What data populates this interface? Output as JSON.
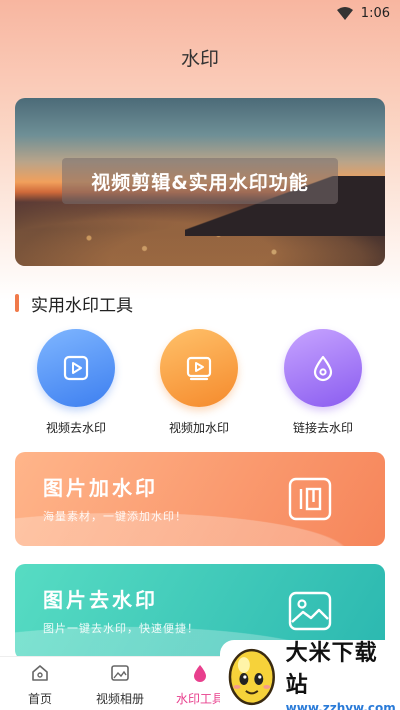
{
  "status_bar": {
    "time": "1:06"
  },
  "header": {
    "title": "水印"
  },
  "banner": {
    "caption": "视频剪辑&实用水印功能"
  },
  "section": {
    "title": "实用水印工具"
  },
  "tools": [
    {
      "label": "视频去水印",
      "icon": "play-icon",
      "color": "#4a8af4"
    },
    {
      "label": "视频加水印",
      "icon": "video-frame-icon",
      "color": "#f7923a"
    },
    {
      "label": "链接去水印",
      "icon": "drop-icon",
      "color": "#9a6af4"
    }
  ],
  "cards": {
    "add": {
      "title": "图片加水印",
      "subtitle": "海量素材，一键添加水印！",
      "icon": "stamp-icon"
    },
    "remove": {
      "title": "图片去水印",
      "subtitle": "图片一键去水印，快速便捷！",
      "icon": "image-icon"
    }
  },
  "tabbar": {
    "items": [
      {
        "label": "首页",
        "icon": "home-icon"
      },
      {
        "label": "视频相册",
        "icon": "photo-album-icon"
      },
      {
        "label": "水印工具",
        "icon": "watermark-tool-icon",
        "active": true
      }
    ],
    "active_color": "#e83f8d"
  },
  "overlay": {
    "name": "大米下载站",
    "url": "www.zzhyw.com"
  }
}
